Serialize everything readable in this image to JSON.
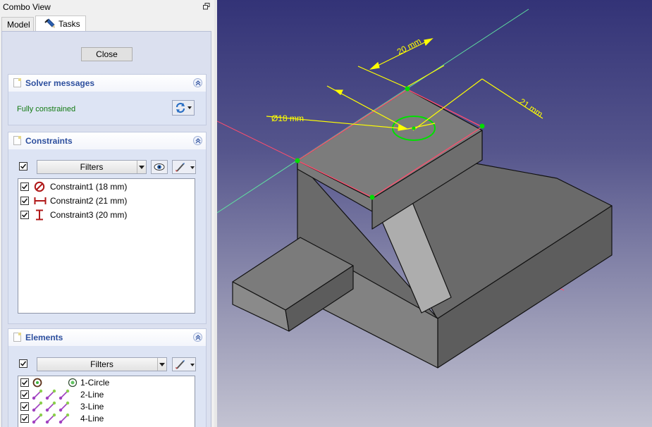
{
  "combo_view": {
    "title": "Combo View",
    "tabs": [
      {
        "label": "Model"
      },
      {
        "label": "Tasks"
      }
    ]
  },
  "tasks": {
    "close_label": "Close",
    "solver": {
      "title": "Solver messages",
      "status": "Fully constrained"
    },
    "constraints": {
      "title": "Constraints",
      "filter_label": "Filters",
      "items": [
        {
          "label": "Constraint1 (18 mm)",
          "icon": "diameter-constraint-icon"
        },
        {
          "label": "Constraint2 (21 mm)",
          "icon": "horizontal-distance-icon"
        },
        {
          "label": "Constraint3 (20 mm)",
          "icon": "vertical-distance-icon"
        }
      ]
    },
    "elements": {
      "title": "Elements",
      "filter_label": "Filters",
      "items": [
        {
          "label": "1-Circle",
          "icon": "circle-element-icon"
        },
        {
          "label": "2-Line",
          "icon": "line-element-icon"
        },
        {
          "label": "3-Line",
          "icon": "line-element-icon"
        },
        {
          "label": "4-Line",
          "icon": "line-element-icon"
        }
      ]
    }
  },
  "viewport": {
    "dimensions": {
      "d20": "20 mm",
      "d21": "21 mm",
      "d18": "Ø18 mm"
    },
    "colors": {
      "background_top": "#333377",
      "background_bottom": "#c3c3d2",
      "body_face": "#787878",
      "dimension": "#ffff00",
      "constraint_point": "#00dd00",
      "sketch_edge": "#ff4d6d",
      "axis_x": "#ff4d6d",
      "axis_y": "#5fe0a0"
    }
  }
}
